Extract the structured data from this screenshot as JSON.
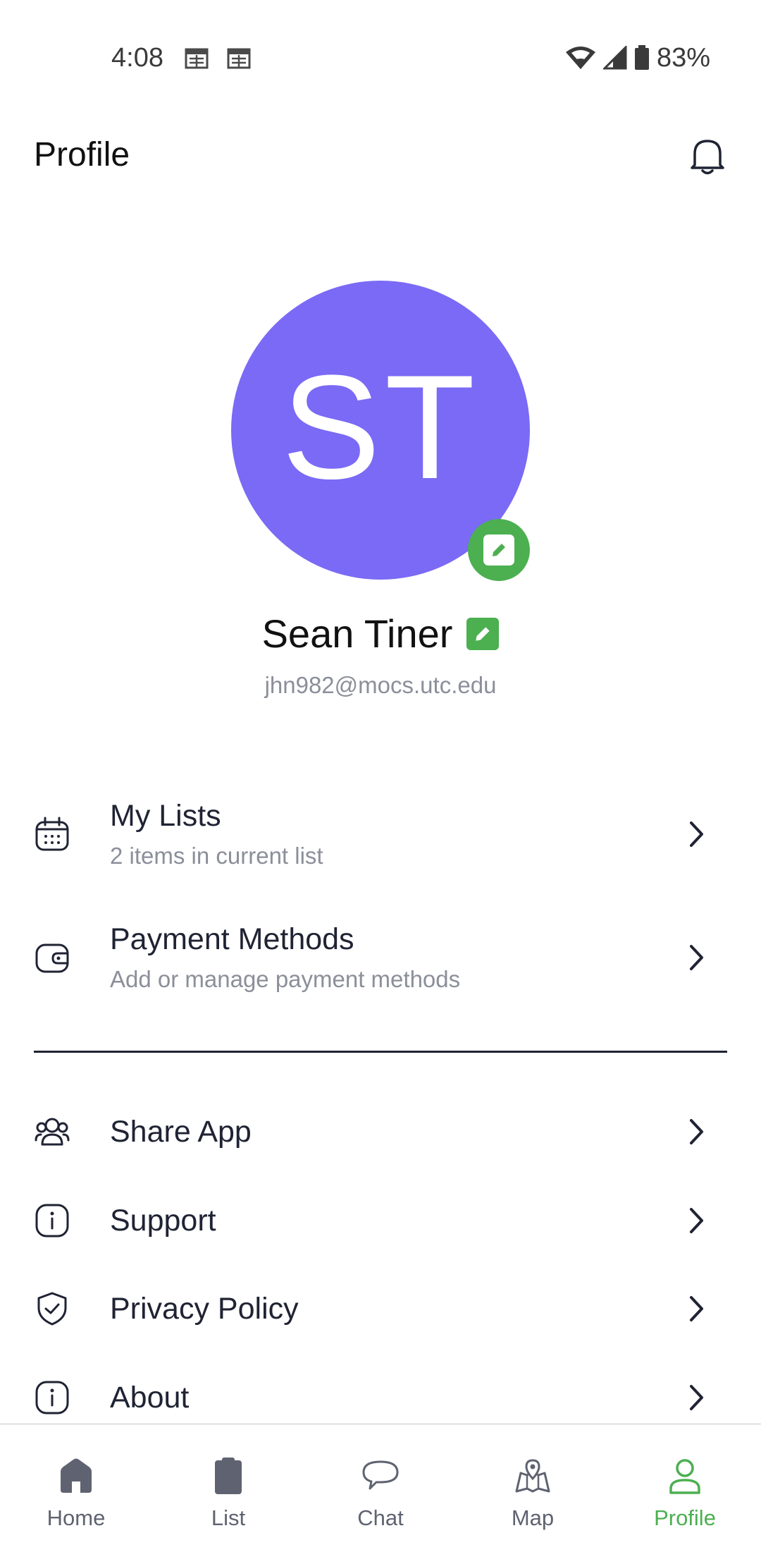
{
  "status_bar": {
    "time": "4:08",
    "battery": "83%"
  },
  "header": {
    "title": "Profile",
    "bell_icon": "bell-icon"
  },
  "profile": {
    "initials": "ST",
    "name": "Sean Tiner",
    "email": "jhn982@mocs.utc.edu",
    "avatar_color": "#7a6af5",
    "accent_color": "#4caf50"
  },
  "menu": {
    "my_lists": {
      "label": "My Lists",
      "subtitle": "2 items in current list",
      "icon": "calendar-icon"
    },
    "payment_methods": {
      "label": "Payment Methods",
      "subtitle": "Add or manage payment methods",
      "icon": "wallet-icon"
    },
    "share_app": {
      "label": "Share App",
      "icon": "users-icon"
    },
    "support": {
      "label": "Support",
      "icon": "info-icon"
    },
    "privacy_policy": {
      "label": "Privacy Policy",
      "icon": "shield-check-icon"
    },
    "about": {
      "label": "About",
      "icon": "info-icon"
    }
  },
  "bottom_nav": {
    "home": "Home",
    "list": "List",
    "chat": "Chat",
    "map": "Map",
    "profile": "Profile",
    "active": "Profile"
  }
}
